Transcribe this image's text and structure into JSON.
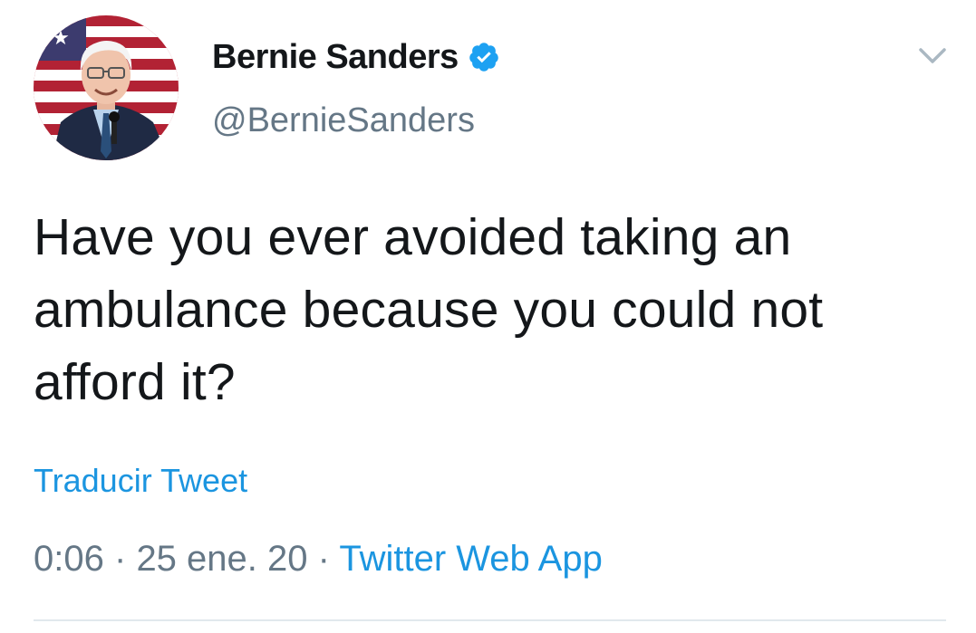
{
  "user": {
    "display_name": "Bernie Sanders",
    "handle": "@BernieSanders",
    "verified": true
  },
  "tweet": {
    "text": "Have you ever avoided taking an ambulance because you could not afford it?",
    "translate_label": "Traducir Tweet",
    "time": "0:06",
    "separator": "·",
    "date": "25 ene. 20",
    "source": "Twitter Web App"
  },
  "colors": {
    "link": "#1b95e0",
    "secondary_text": "#657786",
    "primary_text": "#14171a",
    "verified_badge": "#1da1f2"
  },
  "icons": {
    "verified": "verified-badge-icon",
    "menu": "chevron-down-icon"
  }
}
